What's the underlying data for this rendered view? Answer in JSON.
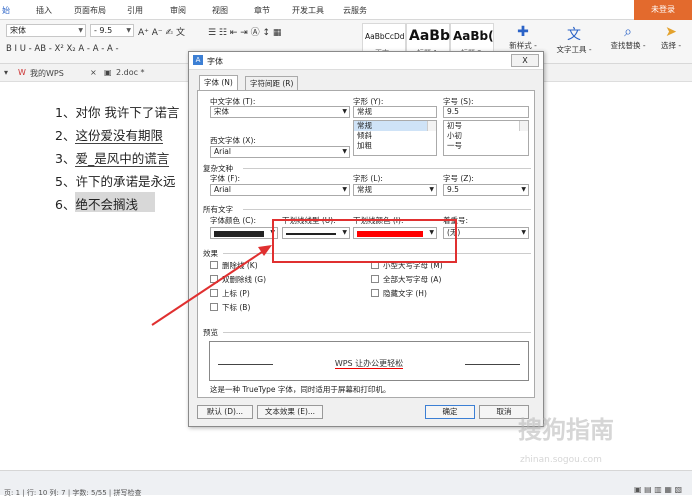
{
  "menu_tabs": [
    "始",
    "插入",
    "页面布局",
    "引用",
    "审阅",
    "视图",
    "章节",
    "开发工具",
    "云服务"
  ],
  "login_label": "未登录",
  "ribbon": {
    "font_name": "宋体",
    "font_size": "- 9.5",
    "styles": [
      {
        "sample": "AaBbCcDd",
        "label": "正文"
      },
      {
        "sample": "AaBb",
        "label": "标题 1"
      },
      {
        "sample": "AaBb(",
        "label": "标题 2"
      }
    ],
    "new_style": "新样式 -",
    "text_tools": "文字工具 -",
    "find_replace": "查找替换 -",
    "select": "选择 -",
    "format_row": "B I U - AB - X² X₂ A - A - A -"
  },
  "doc_tabs": [
    "我的WPS",
    "2.doc *"
  ],
  "doc_lines": [
    {
      "num": "1、",
      "text": "对你 我许下了诺言"
    },
    {
      "num": "2、",
      "text": "这份爱没有期限"
    },
    {
      "num": "3、",
      "text": "爱_是风中的谎言"
    },
    {
      "num": "5、",
      "text": "许下的承诺是永远"
    },
    {
      "num": "6、",
      "text": "绝不会搁浅"
    }
  ],
  "dialog": {
    "title": "字体",
    "close": "X",
    "tabs": [
      "字体 (N)",
      "字符间距 (R)"
    ],
    "cn_font_label": "中文字体 (T):",
    "cn_font_value": "宋体",
    "style_label": "字形 (Y):",
    "style_value": "常规",
    "style_options": [
      "常规",
      "倾斜",
      "加粗"
    ],
    "size_label": "字号 (S):",
    "size_value": "9.5",
    "size_options": [
      "初号",
      "小初",
      "一号"
    ],
    "west_font_label": "西文字体 (X):",
    "west_font_value": "Arial",
    "complex_section": "复杂文种",
    "complex_font_label": "字体 (F):",
    "complex_font_value": "Arial",
    "complex_style_label": "字形 (L):",
    "complex_style_value": "常规",
    "complex_size_label": "字号 (Z):",
    "complex_size_value": "9.5",
    "all_text_section": "所有文字",
    "font_color_label": "字体颜色 (C):",
    "underline_style_label": "下划线线型 (U):",
    "underline_color_label": "下划线颜色 (I):",
    "emphasis_label": "着重号:",
    "emphasis_value": "(无)",
    "effects_section": "效果",
    "effects_left": [
      "删除线 (K)",
      "双删除线 (G)",
      "上标 (P)",
      "下标 (B)"
    ],
    "effects_right": [
      "小型大写字母 (M)",
      "全部大写字母 (A)",
      "隐藏文字 (H)"
    ],
    "preview_section": "预览",
    "preview_text": "WPS 让办公更轻松",
    "note": "这是一种 TrueType 字体，同时适用于屏幕和打印机。",
    "btn_default": "默认 (D)...",
    "btn_text_effect": "文本效果 (E)...",
    "btn_ok": "确定",
    "btn_cancel": "取消"
  },
  "status_text": "页: 1 | 行: 10 列: 7 | 字数: 5/55 | 拼写检查",
  "watermark": "搜狗指南",
  "watermark_url": "zhinan.sogou.com",
  "colors": {
    "accent": "#e36a2d",
    "red": "#e03030",
    "underline_color": "#ff0000",
    "font_color": "#222222"
  }
}
